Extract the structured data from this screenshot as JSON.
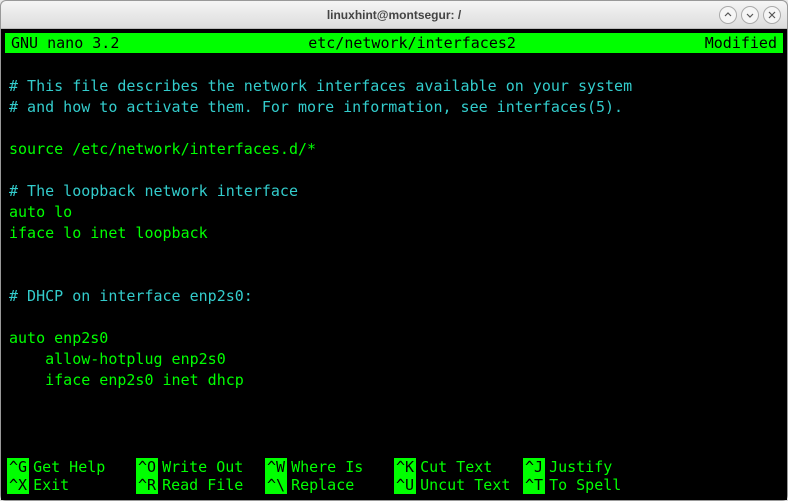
{
  "window": {
    "title": "linuxhint@montsegur: /"
  },
  "nano": {
    "version": "GNU nano 3.2",
    "filepath": "etc/network/interfaces2",
    "status": "Modified"
  },
  "lines": [
    {
      "text": "",
      "cls": "plain"
    },
    {
      "text": "# This file describes the network interfaces available on your system",
      "cls": "comment"
    },
    {
      "text": "# and how to activate them. For more information, see interfaces(5).",
      "cls": "comment"
    },
    {
      "text": "",
      "cls": "plain"
    },
    {
      "text": "source /etc/network/interfaces.d/*",
      "cls": "plain"
    },
    {
      "text": "",
      "cls": "plain"
    },
    {
      "text": "# The loopback network interface",
      "cls": "comment"
    },
    {
      "text": "auto lo",
      "cls": "plain"
    },
    {
      "text": "iface lo inet loopback",
      "cls": "plain"
    },
    {
      "text": "",
      "cls": "plain"
    },
    {
      "text": "",
      "cls": "plain"
    },
    {
      "text": "# DHCP on interface enp2s0:",
      "cls": "comment"
    },
    {
      "text": "",
      "cls": "plain"
    },
    {
      "text": "auto enp2s0",
      "cls": "plain"
    },
    {
      "text": "    allow-hotplug enp2s0",
      "cls": "plain"
    },
    {
      "text": "    iface enp2s0 inet dhcp",
      "cls": "plain"
    },
    {
      "text": "",
      "cls": "plain"
    },
    {
      "text": "",
      "cls": "plain"
    }
  ],
  "shortcuts": [
    {
      "key": "^G",
      "label": "Get Help"
    },
    {
      "key": "^O",
      "label": "Write Out"
    },
    {
      "key": "^W",
      "label": "Where Is"
    },
    {
      "key": "^K",
      "label": "Cut Text"
    },
    {
      "key": "^J",
      "label": "Justify"
    },
    {
      "key": "",
      "label": ""
    },
    {
      "key": "^X",
      "label": "Exit"
    },
    {
      "key": "^R",
      "label": "Read File"
    },
    {
      "key": "^\\",
      "label": "Replace"
    },
    {
      "key": "^U",
      "label": "Uncut Text"
    },
    {
      "key": "^T",
      "label": "To Spell"
    },
    {
      "key": "",
      "label": ""
    }
  ]
}
